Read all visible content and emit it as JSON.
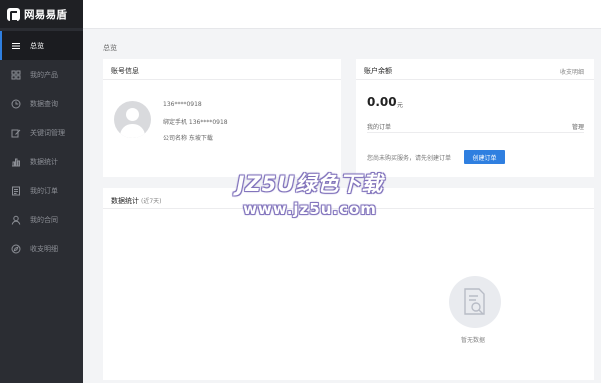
{
  "app": {
    "name": "网易易盾"
  },
  "sidebar": {
    "items": [
      {
        "label": "总览",
        "icon": "menu-icon",
        "active": true
      },
      {
        "label": "我的产品",
        "icon": "grid-icon"
      },
      {
        "label": "数据查询",
        "icon": "clock-icon"
      },
      {
        "label": "关键词管理",
        "icon": "edit-icon"
      },
      {
        "label": "数据统计",
        "icon": "bar-chart-icon"
      },
      {
        "label": "我的订单",
        "icon": "document-icon"
      },
      {
        "label": "我的合同",
        "icon": "user-icon"
      },
      {
        "label": "收支明细",
        "icon": "compass-icon"
      }
    ]
  },
  "breadcrumb": "总览",
  "account": {
    "title": "账号信息",
    "username": "136****0918",
    "phone": "绑定手机  136****0918",
    "company": "公司名称  东坡下载"
  },
  "balance": {
    "title": "账户余额",
    "link": "收支明细",
    "amount": "0.00",
    "unit": "元",
    "orders_label": "我的订单",
    "manage_label": "管理",
    "hint": "您尚未购买服务，请先创建订单",
    "create_button": "创建订单"
  },
  "stats": {
    "title": "数据统计",
    "subtitle": "(近7天)",
    "empty_text": "暂无数据"
  },
  "watermark": {
    "main": "JZ5U绿色下载",
    "sub": "www.jz5u.com"
  },
  "colors": {
    "sidebar_bg": "#2b2d33",
    "accent": "#2f7fe0",
    "page_bg": "#f3f4f6"
  }
}
